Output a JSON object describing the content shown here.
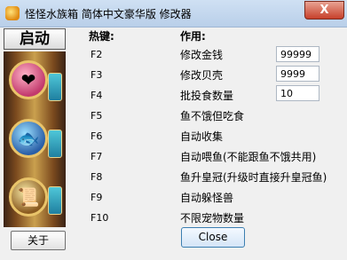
{
  "window": {
    "title": "怪怪水族箱 简体中文豪华版 修改器",
    "close_glyph": "X"
  },
  "sidebar": {
    "start_label": "启动",
    "about_label": "关于"
  },
  "headers": {
    "hotkey": "热键:",
    "function": "作用:"
  },
  "rows": [
    {
      "key": "F2",
      "label": "修改金钱",
      "value": "99999"
    },
    {
      "key": "F3",
      "label": "修改贝壳",
      "value": "9999"
    },
    {
      "key": "F4",
      "label": "批投食数量",
      "value": "10"
    },
    {
      "key": "F5",
      "label": "鱼不饿但吃食"
    },
    {
      "key": "F6",
      "label": "自动收集"
    },
    {
      "key": "F7",
      "label": "自动喂鱼(不能跟鱼不饿共用)"
    },
    {
      "key": "F8",
      "label": "鱼升皇冠(升级时直接升皇冠鱼)"
    },
    {
      "key": "F9",
      "label": "自动躲怪兽"
    },
    {
      "key": "F10",
      "label": "不限宠物数量"
    }
  ],
  "footer": {
    "close_label": "Close"
  }
}
